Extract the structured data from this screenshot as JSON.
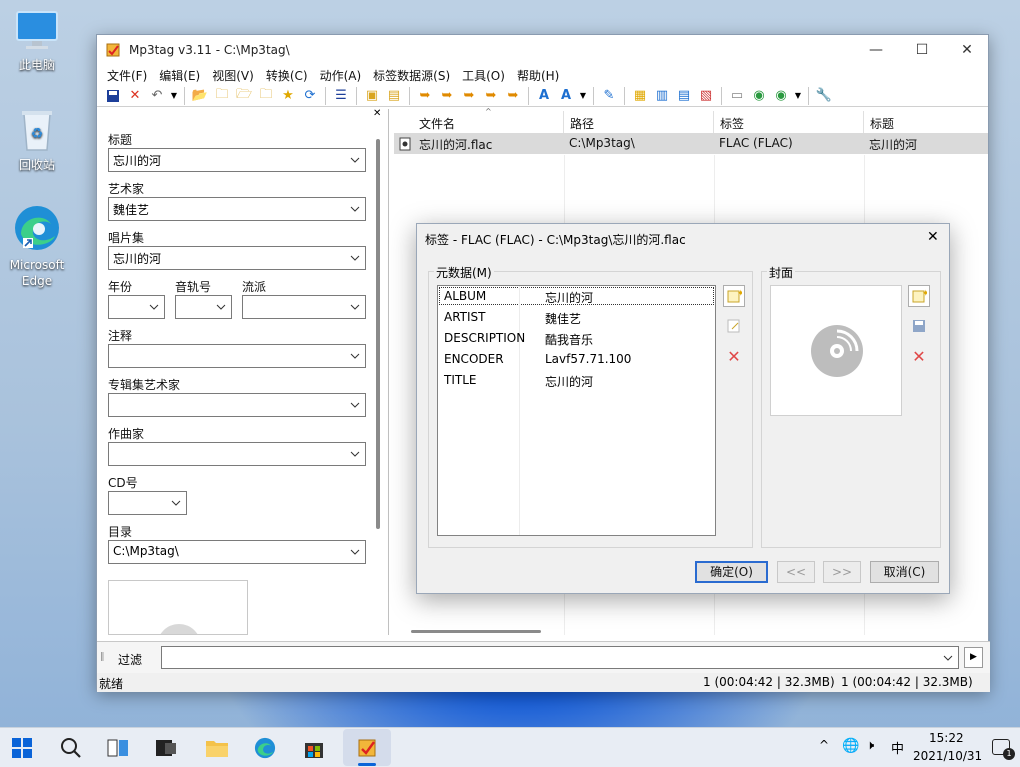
{
  "desktop": {
    "icons": [
      {
        "label": "此电脑"
      },
      {
        "label": "回收站"
      },
      {
        "label": "Microsoft Edge"
      }
    ]
  },
  "window": {
    "title": "Mp3tag v3.11  -  C:\\Mp3tag\\",
    "menu": [
      "文件(F)",
      "编辑(E)",
      "视图(V)",
      "转换(C)",
      "动作(A)",
      "标签数据源(S)",
      "工具(O)",
      "帮助(H)"
    ]
  },
  "tag_panel": {
    "title_label": "标题",
    "title_value": "忘川的河",
    "artist_label": "艺术家",
    "artist_value": "魏佳艺",
    "album_label": "唱片集",
    "album_value": "忘川的河",
    "year_label": "年份",
    "track_label": "音轨号",
    "genre_label": "流派",
    "comment_label": "注释",
    "albumartist_label": "专辑集艺术家",
    "composer_label": "作曲家",
    "cd_label": "CD号",
    "dir_label": "目录",
    "dir_value": "C:\\Mp3tag\\"
  },
  "file_list": {
    "columns": [
      "文件名",
      "路径",
      "标签",
      "标题"
    ],
    "rows": [
      {
        "filename": "忘川的河.flac",
        "path": "C:\\Mp3tag\\",
        "tag": "FLAC (FLAC)",
        "title": "忘川的河"
      }
    ]
  },
  "filter": {
    "label": "过滤",
    "value": ""
  },
  "status": {
    "left": "就绪",
    "count1": "1 (00:04:42 | 32.3MB)",
    "count2": "1 (00:04:42 | 32.3MB)"
  },
  "dialog": {
    "title": "标签 - FLAC (FLAC) - C:\\Mp3tag\\忘川的河.flac",
    "metadata_group": "元数据(M)",
    "cover_group": "封面",
    "fields": [
      {
        "key": "ALBUM",
        "value": "忘川的河"
      },
      {
        "key": "ARTIST",
        "value": "魏佳艺"
      },
      {
        "key": "DESCRIPTION",
        "value": "酷我音乐"
      },
      {
        "key": "ENCODER",
        "value": "Lavf57.71.100"
      },
      {
        "key": "TITLE",
        "value": "忘川的河"
      }
    ],
    "ok_label": "确定(O)",
    "prev_label": "<<",
    "next_label": ">>",
    "cancel_label": "取消(C)"
  },
  "taskbar": {
    "ime": "中",
    "time": "15:22",
    "date": "2021/10/31"
  },
  "colors": {
    "accent": "#2a6bd0",
    "selection": "#dadada",
    "window_bg": "#ffffff",
    "dialog_bg": "#f0f0f0"
  }
}
